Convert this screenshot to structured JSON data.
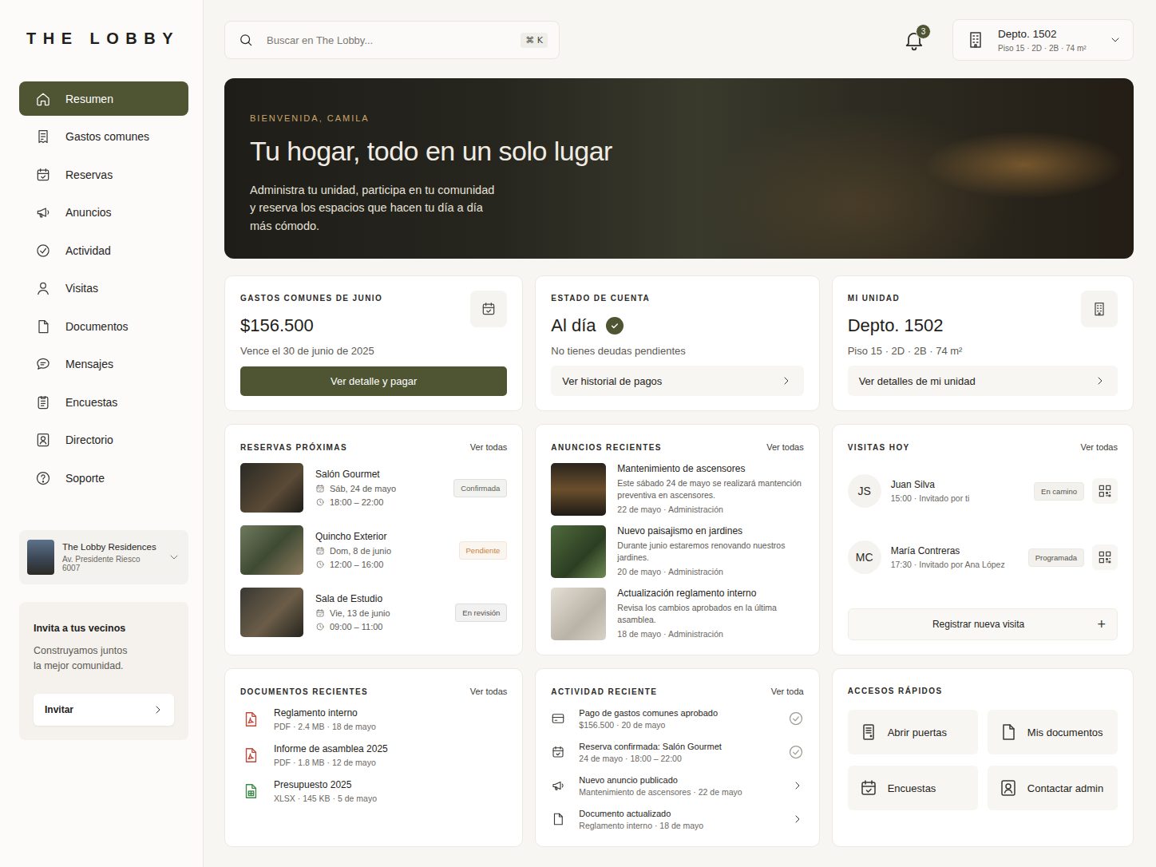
{
  "logo": "THE LOBBY",
  "sidebar": {
    "items": [
      {
        "label": "Resumen",
        "selected": true
      },
      {
        "label": "Gastos comunes",
        "selected": false
      },
      {
        "label": "Reservas",
        "selected": false
      },
      {
        "label": "Anuncios",
        "selected": false
      },
      {
        "label": "Actividad",
        "selected": false
      },
      {
        "label": "Visitas",
        "selected": false
      },
      {
        "label": "Documentos",
        "selected": false
      },
      {
        "label": "Mensajes",
        "selected": false
      },
      {
        "label": "Encuestas",
        "selected": false
      },
      {
        "label": "Directorio",
        "selected": false
      },
      {
        "label": "Soporte",
        "selected": false
      }
    ]
  },
  "building": {
    "name": "The Lobby Residences",
    "address": "Av. Presidente Riesco 6007"
  },
  "invite": {
    "title": "Invita a tus vecinos",
    "lines": [
      "Construyamos juntos",
      "la mejor comunidad."
    ],
    "button": "Invitar"
  },
  "search": {
    "placeholder": "Buscar en The Lobby...",
    "shortcut": "⌘ K"
  },
  "notifications": {
    "count": "3"
  },
  "unit_selector": {
    "title": "Depto. 1502",
    "subtitle": "Piso 15 · 2D · 2B · 74 m²"
  },
  "hero": {
    "eyebrow": "BIENVENIDA, CAMILA",
    "title": "Tu hogar, todo en un solo lugar",
    "lines": [
      "Administra tu unidad, participa en tu comunidad",
      "y reserva los espacios que hacen tu día a día",
      "más cómodo."
    ]
  },
  "expenses": {
    "label": "GASTOS COMUNES DE JUNIO",
    "amount": "$156.500",
    "due": "Vence el 30 de junio de 2025",
    "button": "Ver detalle y pagar"
  },
  "account": {
    "label": "ESTADO DE CUENTA",
    "status": "Al día",
    "ok": true,
    "note": "No tienes deudas pendientes",
    "link": "Ver historial de pagos"
  },
  "unit": {
    "label": "MI UNIDAD",
    "title": "Depto. 1502",
    "details": "Piso 15 · 2D · 2B · 74 m²",
    "link": "Ver detalles de mi unidad"
  },
  "reservations": {
    "title": "RESERVAS PRÓXIMAS",
    "link": "Ver todas",
    "items": [
      {
        "name": "Salón Gourmet",
        "date": "Sáb, 24 de mayo",
        "time": "18:00 – 22:00",
        "status": "Confirmada",
        "color": "#5d6650"
      },
      {
        "name": "Quincho Exterior",
        "date": "Dom, 8 de junio",
        "time": "12:00 – 16:00",
        "status": "Pendiente",
        "color": "#c9833a"
      },
      {
        "name": "Sala de Estudio",
        "date": "Vie, 13 de junio",
        "time": "09:00 – 11:00",
        "status": "En revisión",
        "color": "#55524c"
      }
    ]
  },
  "announcements": {
    "title": "ANUNCIOS RECIENTES",
    "link": "Ver todas",
    "items": [
      {
        "title": "Mantenimiento de ascensores",
        "text": "Este sábado 24 de mayo se realizará mantención preventiva en ascensores.",
        "meta": "22 de mayo · Administración"
      },
      {
        "title": "Nuevo paisajismo en jardines",
        "text": "Durante junio estaremos renovando nuestros jardines.",
        "meta": "20 de mayo · Administración"
      },
      {
        "title": "Actualización reglamento interno",
        "text": "Revisa los cambios aprobados en la última asamblea.",
        "meta": "18 de mayo · Administración"
      }
    ]
  },
  "visits": {
    "title": "VISITAS HOY",
    "link": "Ver todas",
    "items": [
      {
        "initials": "JS",
        "name": "Juan Silva",
        "meta": "15:00 · Invitado por ti",
        "status": "En camino"
      },
      {
        "initials": "MC",
        "name": "María Contreras",
        "meta": "17:30 · Invitado por Ana López",
        "status": "Programada"
      }
    ],
    "button": "Registrar nueva visita",
    "button_icon": "+"
  },
  "documents": {
    "title": "DOCUMENTOS RECIENTES",
    "link": "Ver todas",
    "items": [
      {
        "name": "Reglamento interno",
        "meta": "PDF · 2.4 MB · 18 de mayo",
        "kind": "pdf",
        "color": "#c0483a"
      },
      {
        "name": "Informe de asamblea 2025",
        "meta": "PDF · 1.8 MB · 12 de mayo",
        "kind": "pdf",
        "color": "#c0483a"
      },
      {
        "name": "Presupuesto 2025",
        "meta": "XLSX · 145 KB · 5 de mayo",
        "kind": "xlsx",
        "color": "#3f8a4a"
      }
    ]
  },
  "activity": {
    "title": "ACTIVIDAD RECIENTE",
    "link": "Ver toda",
    "items": [
      {
        "title": "Pago de gastos comunes aprobado",
        "meta": "$156.500 · 20 de mayo",
        "done": true
      },
      {
        "title": "Reserva confirmada: Salón Gourmet",
        "meta": "24 de mayo · 18:00 – 22:00",
        "done": true
      },
      {
        "title": "Nuevo anuncio publicado",
        "meta": "Mantenimiento de ascensores · 22 de mayo",
        "done": false
      },
      {
        "title": "Documento actualizado",
        "meta": "Reglamento interno · 18 de mayo",
        "done": false
      }
    ]
  },
  "quick_access": {
    "title": "ACCESOS RÁPIDOS",
    "items": [
      "Abrir puertas",
      "Mis documentos",
      "Encuestas",
      "Contactar admin"
    ]
  }
}
